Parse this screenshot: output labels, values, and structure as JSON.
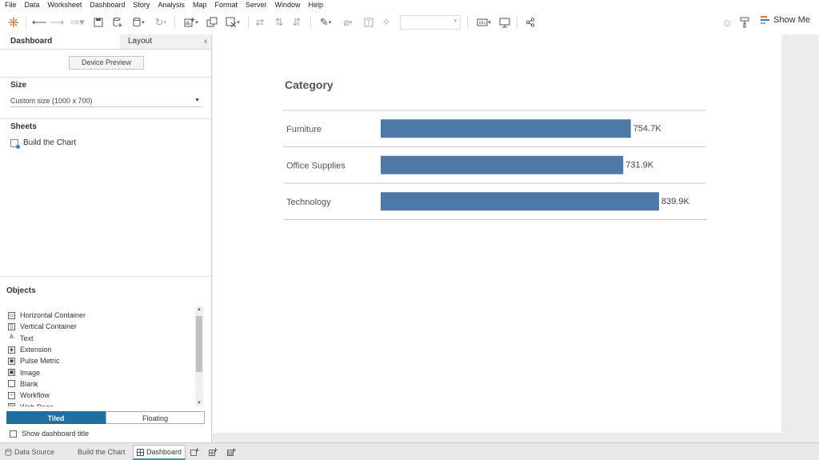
{
  "menu": [
    "File",
    "Data",
    "Worksheet",
    "Dashboard",
    "Story",
    "Analysis",
    "Map",
    "Format",
    "Server",
    "Window",
    "Help"
  ],
  "toolbar": {
    "show_me_label": "Show Me"
  },
  "left_panel": {
    "tabs": [
      "Dashboard",
      "Layout"
    ],
    "device_preview_label": "Device Preview",
    "size_title": "Size",
    "size_value": "Custom size (1000 x 700)",
    "sheets_title": "Sheets",
    "sheets": [
      "Build the Chart"
    ],
    "objects_title": "Objects",
    "objects": [
      {
        "label": "Horizontal Container",
        "icon": "horizontal-container-icon"
      },
      {
        "label": "Vertical Container",
        "icon": "vertical-container-icon"
      },
      {
        "label": "Text",
        "icon": "text-icon"
      },
      {
        "label": "Extension",
        "icon": "extension-icon"
      },
      {
        "label": "Pulse Metric",
        "icon": "pulse-metric-icon"
      },
      {
        "label": "Image",
        "icon": "image-icon"
      },
      {
        "label": "Blank",
        "icon": "blank-icon"
      },
      {
        "label": "Workflow",
        "icon": "workflow-icon"
      },
      {
        "label": "Web Page",
        "icon": "web-page-icon"
      }
    ],
    "tiled_label": "Tiled",
    "floating_label": "Floating",
    "show_title_label": "Show dashboard title"
  },
  "bottom_tabs": {
    "data_source": "Data Source",
    "sheet": "Build the Chart",
    "dashboard": "Dashboard"
  },
  "chart_data": {
    "type": "bar",
    "orientation": "horizontal",
    "title": "Category",
    "categories": [
      "Furniture",
      "Office Supplies",
      "Technology"
    ],
    "values": [
      754.7,
      731.9,
      839.9
    ],
    "value_labels": [
      "754.7K",
      "731.9K",
      "839.9K"
    ],
    "xlim": [
      0,
      839.9
    ],
    "bar_color": "#4e79a7",
    "grid": false
  }
}
